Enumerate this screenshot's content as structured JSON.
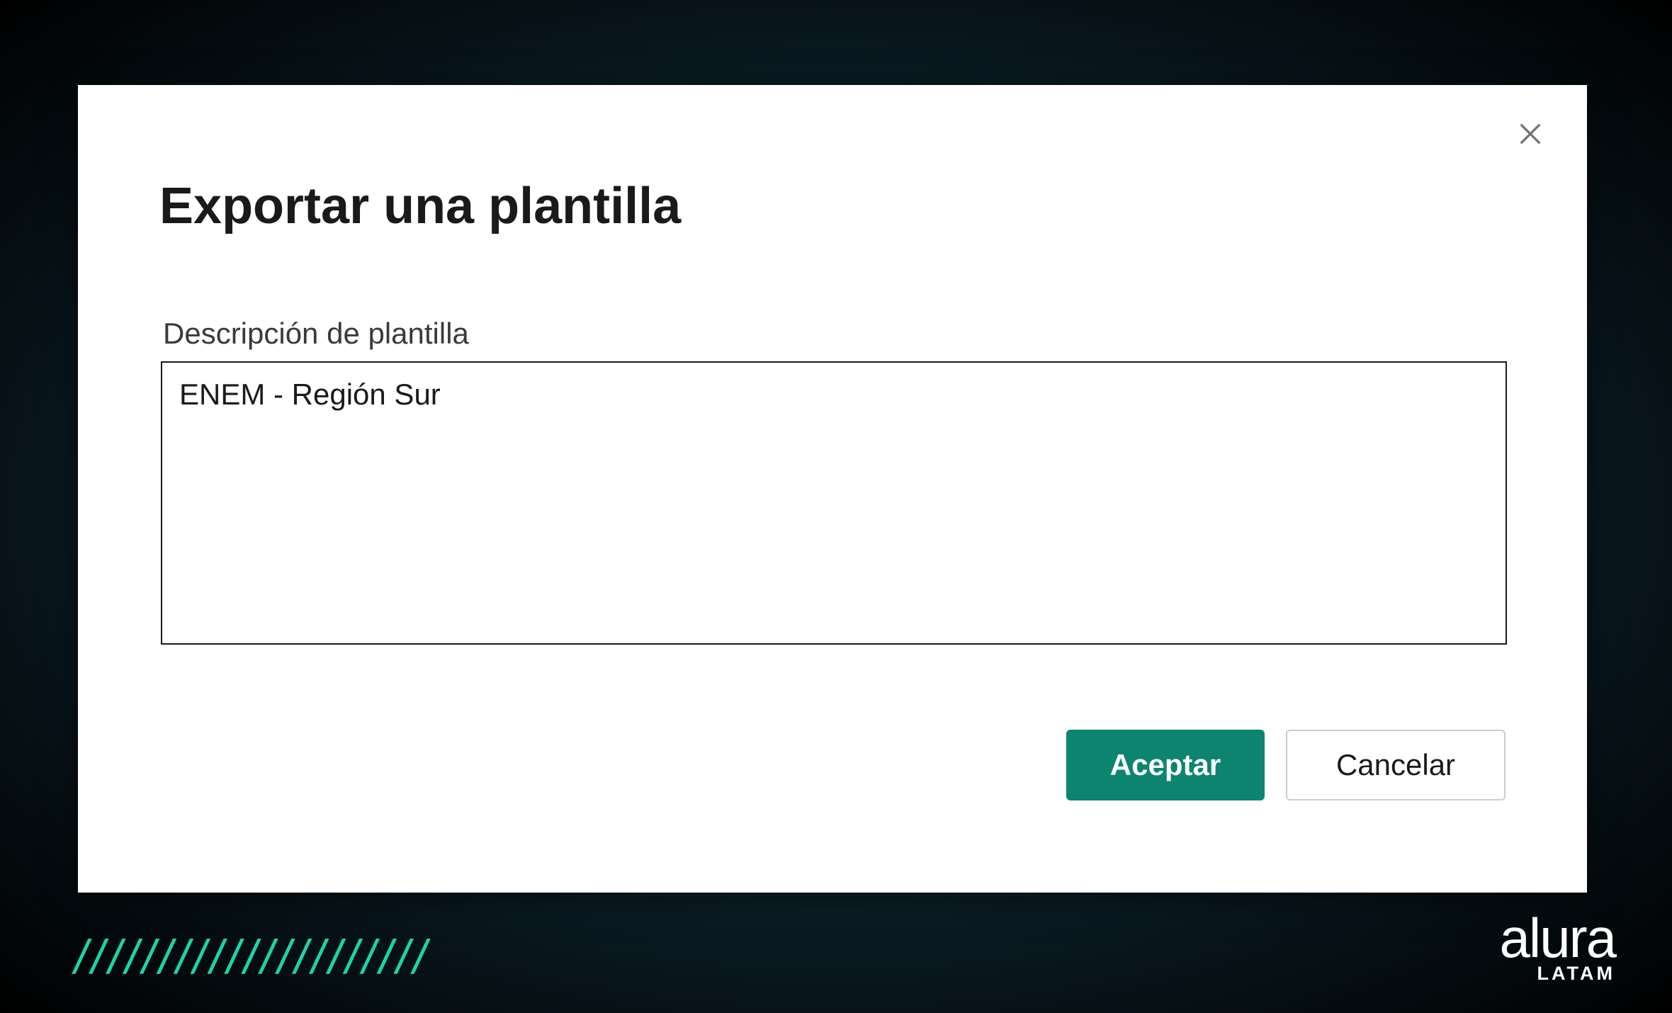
{
  "dialog": {
    "title": "Exportar una plantilla",
    "field_label": "Descripción de plantilla",
    "description_value": "ENEM - Región Sur",
    "accept_label": "Aceptar",
    "cancel_label": "Cancelar"
  },
  "branding": {
    "logo_main": "alura",
    "logo_sub": "LATAM",
    "slash_count": 21
  }
}
